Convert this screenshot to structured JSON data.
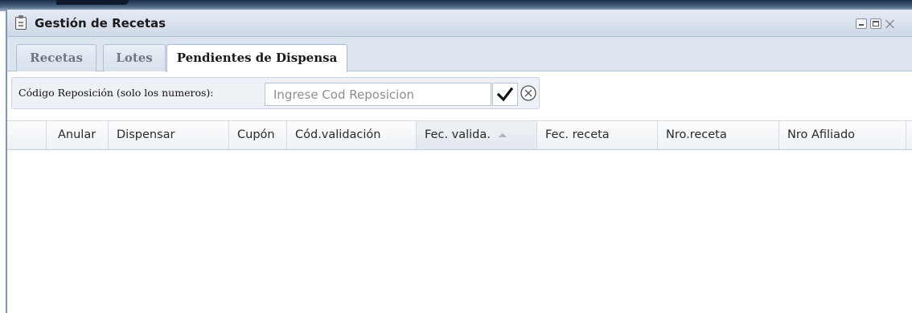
{
  "window": {
    "title": "Gestión de Recetas"
  },
  "tabs": [
    {
      "label": "Recetas",
      "active": false
    },
    {
      "label": "Lotes",
      "active": false
    },
    {
      "label": "Pendientes de Dispensa",
      "active": true
    }
  ],
  "filter": {
    "label": "Código Reposición (solo los numeros):",
    "input_value": "",
    "input_placeholder": "Ingrese Cod Reposicion",
    "confirm_icon": "checkmark-icon",
    "clear_icon": "circle-x-icon"
  },
  "grid": {
    "columns": [
      {
        "label": ""
      },
      {
        "label": "Anular"
      },
      {
        "label": "Dispensar"
      },
      {
        "label": "Cupón"
      },
      {
        "label": "Cód.validación"
      },
      {
        "label": "Fec. valida.",
        "sort": "ascending"
      },
      {
        "label": "Fec. receta"
      },
      {
        "label": "Nro.receta"
      },
      {
        "label": "Nro Afiliado"
      }
    ],
    "rows": []
  },
  "colors": {
    "titlebar": "#d7e1ed",
    "accent_border": "#b3c3d6",
    "active_tab": "#ffffff"
  }
}
